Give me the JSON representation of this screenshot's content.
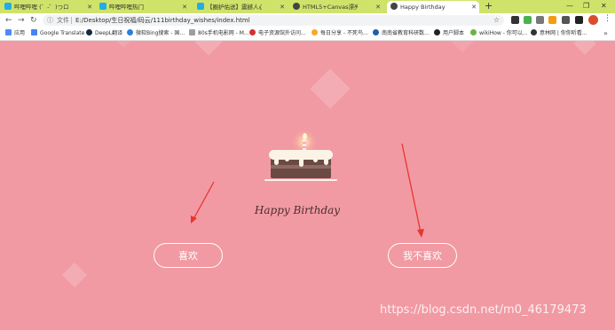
{
  "tabs": [
    {
      "title": "哔哩哔哩 (゜-゜)つロ 干杯~-bili",
      "active": false
    },
    {
      "title": "哔哩哔哩热门",
      "active": false
    },
    {
      "title": "【圈护佑送】震撼人心！没想到",
      "active": false
    },
    {
      "title": "HTML5+Canvas漂亮的3D烟花",
      "active": false
    },
    {
      "title": "Happy Birthday",
      "active": true
    }
  ],
  "toolbar": {
    "file_label": "文件",
    "url": "E:/Desktop/生日祝福/码云/111birthday_wishes/index.html"
  },
  "bookmarks": [
    {
      "label": "应用",
      "color": "#4c8bf5"
    },
    {
      "label": "Google Translate",
      "color": "#4285f4"
    },
    {
      "label": "DeepL翻译",
      "color": "#0f2b46"
    },
    {
      "label": "微软Bing搜索 - 国...",
      "color": "#2b7fd8"
    },
    {
      "label": "80s手机电影网 - M...",
      "color": "#9e9e9e"
    },
    {
      "label": "电子资源馆外访问...",
      "color": "#d32f2f"
    },
    {
      "label": "每日分享 - 不死鸟...",
      "color": "#f9a825"
    },
    {
      "label": "南南省教育科研数...",
      "color": "#1e5fa8"
    },
    {
      "label": "用户脚本",
      "color": "#222222"
    },
    {
      "label": "wikiHow - 你可以...",
      "color": "#6bb344"
    },
    {
      "label": "意林网 | 你你听看...",
      "color": "#333333"
    }
  ],
  "page": {
    "title": "Happy Birthday",
    "like_button": "喜欢",
    "dislike_button": "我不喜欢",
    "watermark": "https://blog.csdn.net/m0_46179473"
  },
  "colors": {
    "background": "#f19aa3",
    "tab_strip": "#cfe36a",
    "arrow": "#e8362f"
  }
}
